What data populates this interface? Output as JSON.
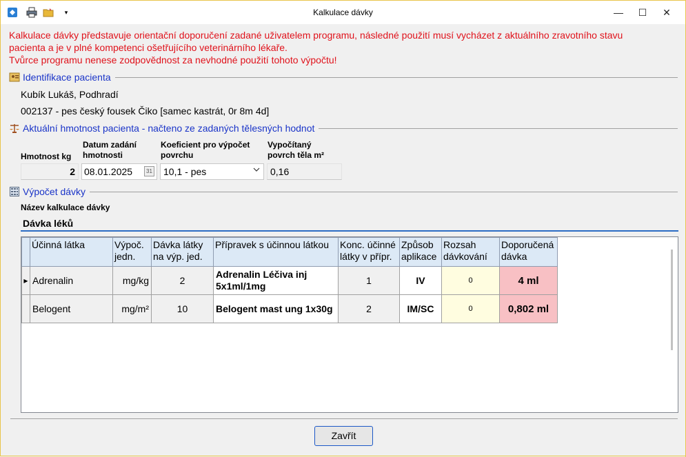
{
  "window": {
    "title": "Kalkulace dávky",
    "quick_access": [
      "app-icon",
      "print-icon",
      "folder-icon",
      "customize-icon"
    ],
    "controls": {
      "minimize": "—",
      "maximize": "☐",
      "close": "✕"
    }
  },
  "warning": {
    "line1": "Kalkulace dávky představuje orientační doporučení zadané uživatelem programu, následné použití musí vycházet z aktuálního zravotního stavu",
    "line2": "pacienta a je v plné kompetenci ošetřujícího veterinárního lékaře.",
    "line3": "Tvůrce programu nenese zodpovědnost za nevhodné použití tohoto výpočtu!",
    "color": "#e0121b"
  },
  "patient": {
    "section_label": "Identifikace pacienta",
    "owner": "Kubík Lukáš, Podhradí",
    "animal": "002137 - pes český fousek Čiko [samec kastrát, 0r  8m  4d]"
  },
  "weight": {
    "section_label": "Aktuální hmotnost pacienta - načteno ze zadaných tělesných hodnot",
    "labels": {
      "weight_kg": "Hmotnost kg",
      "date_line1": "Datum zadání",
      "date_line2": "hmotnosti",
      "coef_line1": "Koeficient pro výpočet",
      "coef_line2": "povrchu",
      "surface_line1": "Vypočítaný",
      "surface_line2": "povrch těla m²"
    },
    "values": {
      "weight_kg": "2",
      "date": "08.01.2025",
      "coef": "10,1 - pes",
      "surface": "0,16"
    }
  },
  "dose": {
    "section_label": "Výpočet dávky",
    "name_label": "Název kalkulace dávky",
    "name_value": "Dávka léků",
    "columns": [
      "Účinná látka",
      "Výpoč. jedn.",
      "Dávka látky na výp. jed.",
      "Přípravek s účinnou látkou",
      "Konc. účinné látky v přípr.",
      "Způsob aplikace",
      "Rozsah dávkování",
      "Doporučená dávka"
    ],
    "rows": [
      {
        "indicator": "▶",
        "substance": "Adrenalin",
        "unit": "mg/kg",
        "dose": "2",
        "product": "Adrenalin Léčiva inj 5x1ml/1mg",
        "conc": "1",
        "route": "IV",
        "range": "0",
        "recommended": "4 ml"
      },
      {
        "indicator": "",
        "substance": "Belogent",
        "unit": "mg/m²",
        "dose": "10",
        "product": "Belogent mast ung 1x30g",
        "conc": "2",
        "route": "IM/SC",
        "range": "0",
        "recommended": "0,802 ml"
      }
    ]
  },
  "footer": {
    "close_button": "Zavřít"
  }
}
